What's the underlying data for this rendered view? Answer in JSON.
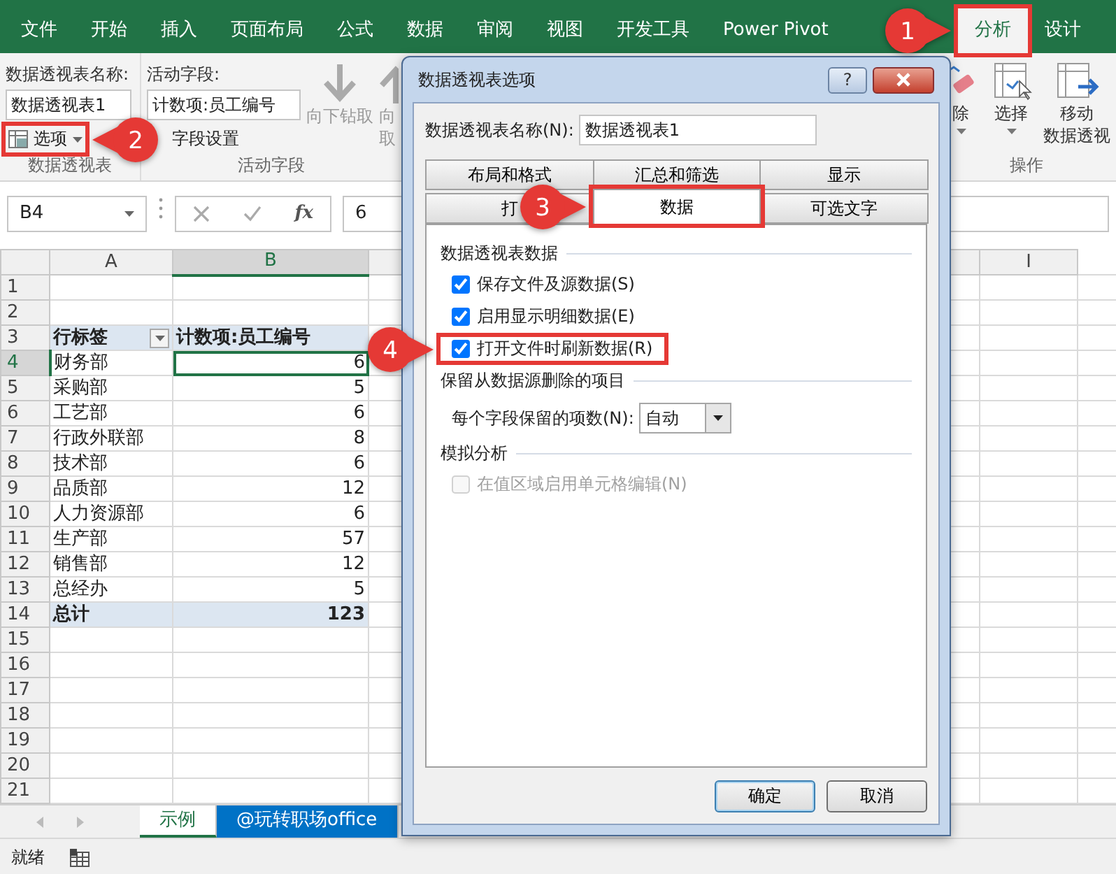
{
  "ribbon_tabs": [
    {
      "label": "文件",
      "selected": false
    },
    {
      "label": "开始",
      "selected": false
    },
    {
      "label": "插入",
      "selected": false
    },
    {
      "label": "页面布局",
      "selected": false
    },
    {
      "label": "公式",
      "selected": false
    },
    {
      "label": "数据",
      "selected": false
    },
    {
      "label": "审阅",
      "selected": false
    },
    {
      "label": "视图",
      "selected": false
    },
    {
      "label": "开发工具",
      "selected": false
    },
    {
      "label": "Power Pivot",
      "selected": false
    },
    {
      "label": "分析",
      "selected": true,
      "callout": {
        "number": "1",
        "points_left": false
      }
    },
    {
      "label": "设计",
      "selected": false
    }
  ],
  "ribbon": {
    "pivot_name_label": "数据透视表名称:",
    "pivot_name": "数据透视表1",
    "options_button": {
      "label": "选项",
      "callout": {
        "number": "2",
        "points_left": true
      }
    },
    "pivot_group": "数据透视表",
    "active_field_label": "活动字段:",
    "active_field": "计数项:员工编号",
    "field_settings": "字段设置",
    "drill_down": "向下钻取",
    "drill_up": [
      "向",
      "取"
    ],
    "active_field_group": "活动字段",
    "clear": "除",
    "select": "选择",
    "move": [
      "移动",
      "数据透视"
    ],
    "actions_group": "操作"
  },
  "formula_bar": {
    "name_box": "B4",
    "function_label": "fx",
    "value": "6"
  },
  "sheet": {
    "columns": [
      {
        "label": "A",
        "selected": false
      },
      {
        "label": "B",
        "selected": true
      },
      {
        "label": "I",
        "selected": false
      }
    ],
    "rows": [
      {
        "number": "1",
        "kind": "blank",
        "selected": false
      },
      {
        "number": "2",
        "kind": "blank",
        "selected": false
      },
      {
        "number": "3",
        "kind": "header",
        "label": "行标签",
        "value": "计数项:员工编号",
        "selected": false
      },
      {
        "number": "4",
        "kind": "item",
        "label": "财务部",
        "value": "6",
        "selected": true
      },
      {
        "number": "5",
        "kind": "item",
        "label": "采购部",
        "value": "5",
        "selected": false
      },
      {
        "number": "6",
        "kind": "item",
        "label": "工艺部",
        "value": "6",
        "selected": false
      },
      {
        "number": "7",
        "kind": "item",
        "label": "行政外联部",
        "value": "8",
        "selected": false
      },
      {
        "number": "8",
        "kind": "item",
        "label": "技术部",
        "value": "6",
        "selected": false
      },
      {
        "number": "9",
        "kind": "item",
        "label": "品质部",
        "value": "12",
        "selected": false
      },
      {
        "number": "10",
        "kind": "item",
        "label": "人力资源部",
        "value": "6",
        "selected": false
      },
      {
        "number": "11",
        "kind": "item",
        "label": "生产部",
        "value": "57",
        "selected": false
      },
      {
        "number": "12",
        "kind": "item",
        "label": "销售部",
        "value": "12",
        "selected": false
      },
      {
        "number": "13",
        "kind": "item",
        "label": "总经办",
        "value": "5",
        "selected": false
      },
      {
        "number": "14",
        "kind": "total",
        "label": "总计",
        "value": "123",
        "selected": false
      },
      {
        "number": "15",
        "kind": "blank",
        "selected": false
      },
      {
        "number": "16",
        "kind": "blank",
        "selected": false
      },
      {
        "number": "17",
        "kind": "blank",
        "selected": false
      },
      {
        "number": "18",
        "kind": "blank",
        "selected": false
      },
      {
        "number": "19",
        "kind": "blank",
        "selected": false
      },
      {
        "number": "20",
        "kind": "blank",
        "selected": false
      },
      {
        "number": "21",
        "kind": "blank",
        "selected": false
      }
    ]
  },
  "sheet_tabs": [
    {
      "label": "示例",
      "selected": true
    },
    {
      "label": "@玩转职场office",
      "selected": false,
      "color": "#0072c6"
    }
  ],
  "status_bar": {
    "text": "就绪"
  },
  "dialog": {
    "title": "数据透视表选项",
    "help_label": "?",
    "name_label": "数据透视表名称(N):",
    "name_value": "数据透视表1",
    "tab_rows": [
      [
        {
          "label": "布局和格式",
          "selected": false
        },
        {
          "label": "汇总和筛选",
          "selected": false
        },
        {
          "label": "显示",
          "selected": false
        }
      ],
      [
        {
          "label": "打",
          "selected": false
        },
        {
          "label": "数据",
          "selected": true,
          "callout": {
            "number": "3",
            "points_left": false
          }
        },
        {
          "label": "可选文字",
          "selected": false
        }
      ]
    ],
    "items": [
      {
        "kind": "heading",
        "text": "数据透视表数据"
      },
      {
        "kind": "checkbox",
        "label": "保存文件及源数据(S)",
        "checked": true,
        "disabled": false
      },
      {
        "kind": "checkbox",
        "label": "启用显示明细数据(E)",
        "checked": true,
        "disabled": false
      },
      {
        "kind": "checkbox",
        "label": "打开文件时刷新数据(R)",
        "checked": true,
        "disabled": false,
        "callout": {
          "number": "4",
          "points_left": false
        }
      },
      {
        "kind": "heading",
        "text": "保留从数据源删除的项目"
      },
      {
        "kind": "select",
        "label": "每个字段保留的项数(N):",
        "value": "自动"
      },
      {
        "kind": "heading",
        "text": "模拟分析"
      },
      {
        "kind": "checkbox",
        "label": "在值区域启用单元格编辑(N)",
        "checked": false,
        "disabled": true
      }
    ],
    "buttons": [
      "确定",
      "取消"
    ]
  }
}
